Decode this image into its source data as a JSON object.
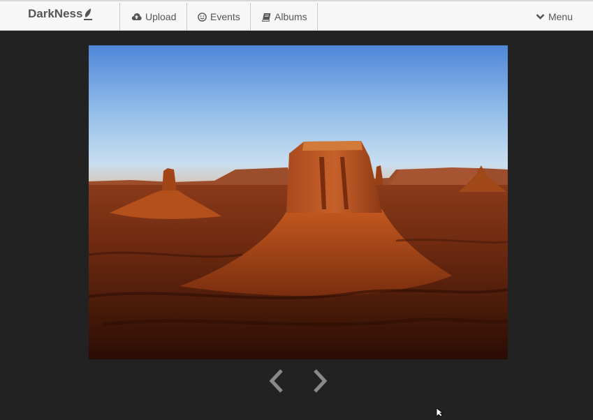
{
  "navbar": {
    "brand": "DarkNess",
    "brand_icon": "leaf-icon",
    "items": [
      {
        "label": "Upload",
        "icon": "cloud-upload-icon"
      },
      {
        "label": "Events",
        "icon": "smile-icon"
      },
      {
        "label": "Albums",
        "icon": "book-icon"
      }
    ],
    "menu_label": "Menu",
    "menu_icon": "chevron-down-icon"
  },
  "viewer": {
    "image_subject": "desert-butte-photo",
    "prev_icon": "chevron-left-icon",
    "next_icon": "chevron-right-icon"
  },
  "colors": {
    "background": "#222222",
    "navbar_background": "#f7f7f7",
    "nav_text": "#555555",
    "pager_arrow": "#8a8a8a"
  }
}
